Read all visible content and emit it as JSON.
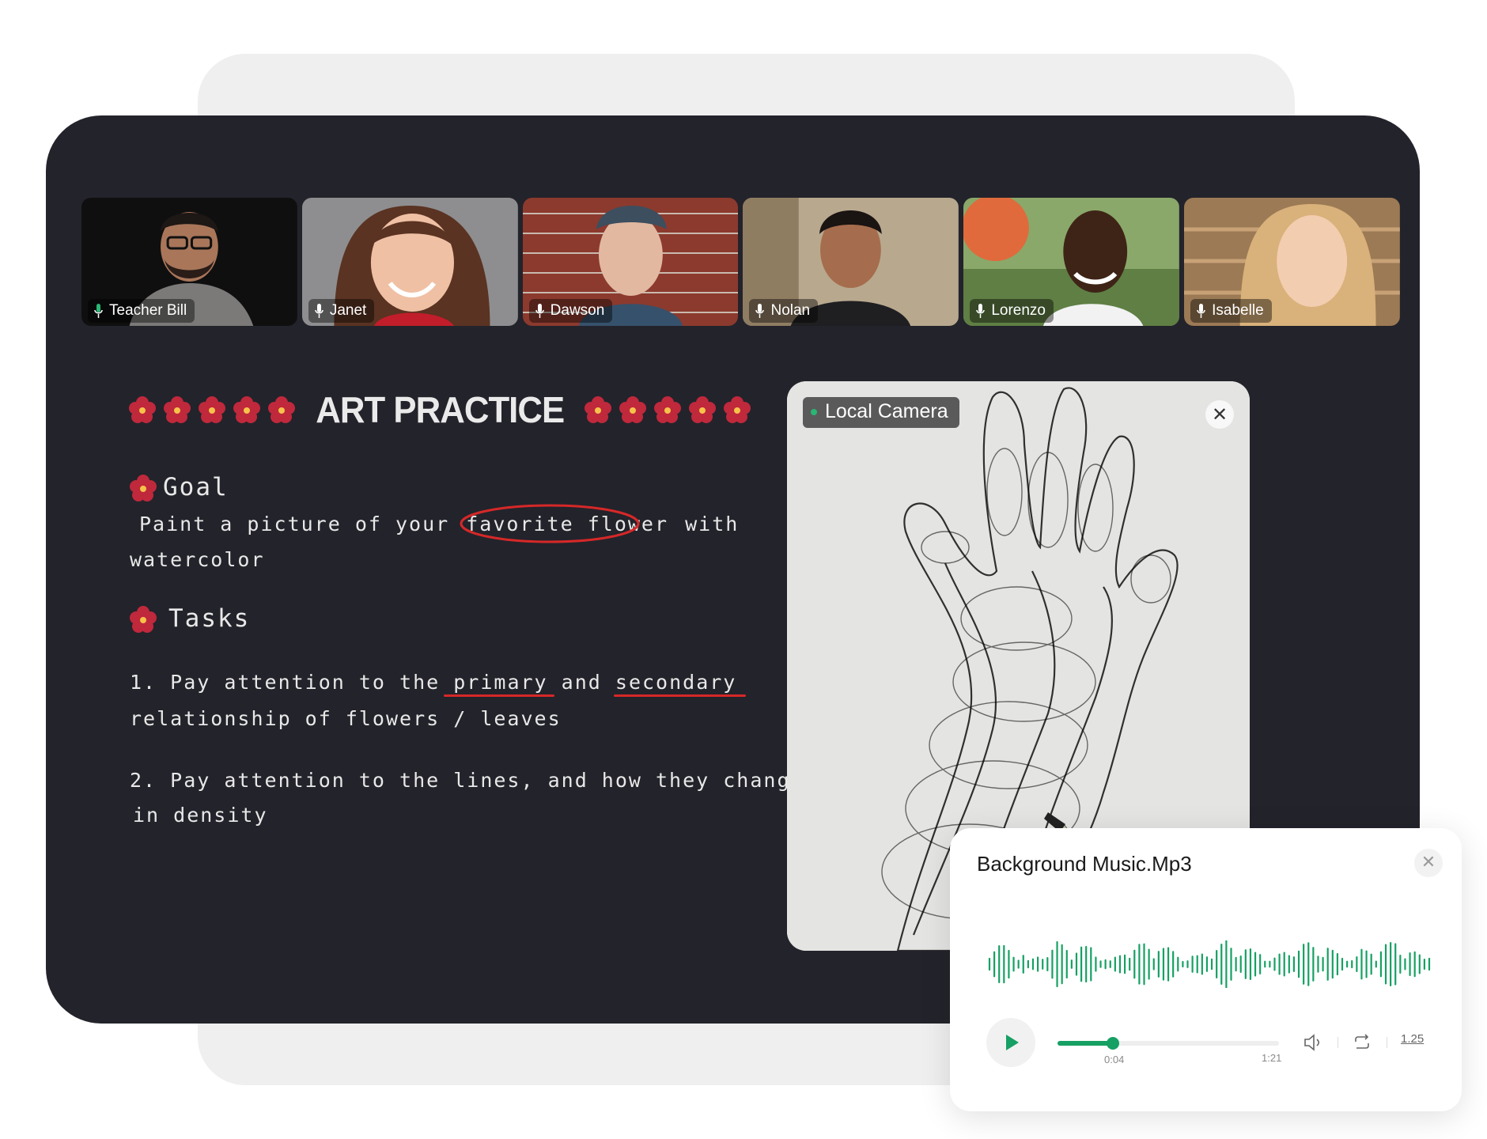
{
  "participants": [
    {
      "name": "Teacher Bill",
      "mic": "active"
    },
    {
      "name": "Janet"
    },
    {
      "name": "Dawson"
    },
    {
      "name": "Nolan"
    },
    {
      "name": "Lorenzo"
    },
    {
      "name": "Isabelle"
    }
  ],
  "notes": {
    "title": "ART PRACTICE",
    "goal_heading": "Goal",
    "goal_line1_a": "Paint a picture of your",
    "goal_line1_circled": "favorite flower",
    "goal_line1_b": "with",
    "goal_line2": "watercolor",
    "tasks_heading": "Tasks",
    "task1_line1_a": "1. Pay attention to the",
    "task1_primary": "primary",
    "task1_and": "and",
    "task1_secondary": "secondary",
    "task1_line2": "relationship of flowers / leaves",
    "task2_line1": "2. Pay attention to the lines, and how they change",
    "task2_line2": "in density"
  },
  "camera": {
    "label": "Local Camera",
    "close_glyph": "✕"
  },
  "player": {
    "title": "Background Music.Mp3",
    "close_glyph": "✕",
    "current_time": "0:04",
    "duration": "1:21",
    "progress": 0.25,
    "speed": "1.25",
    "accent_color": "#16a063"
  },
  "colors": {
    "board_bg": "#23232b",
    "annotation_red": "#d62828",
    "flower_red": "#c0283c"
  }
}
